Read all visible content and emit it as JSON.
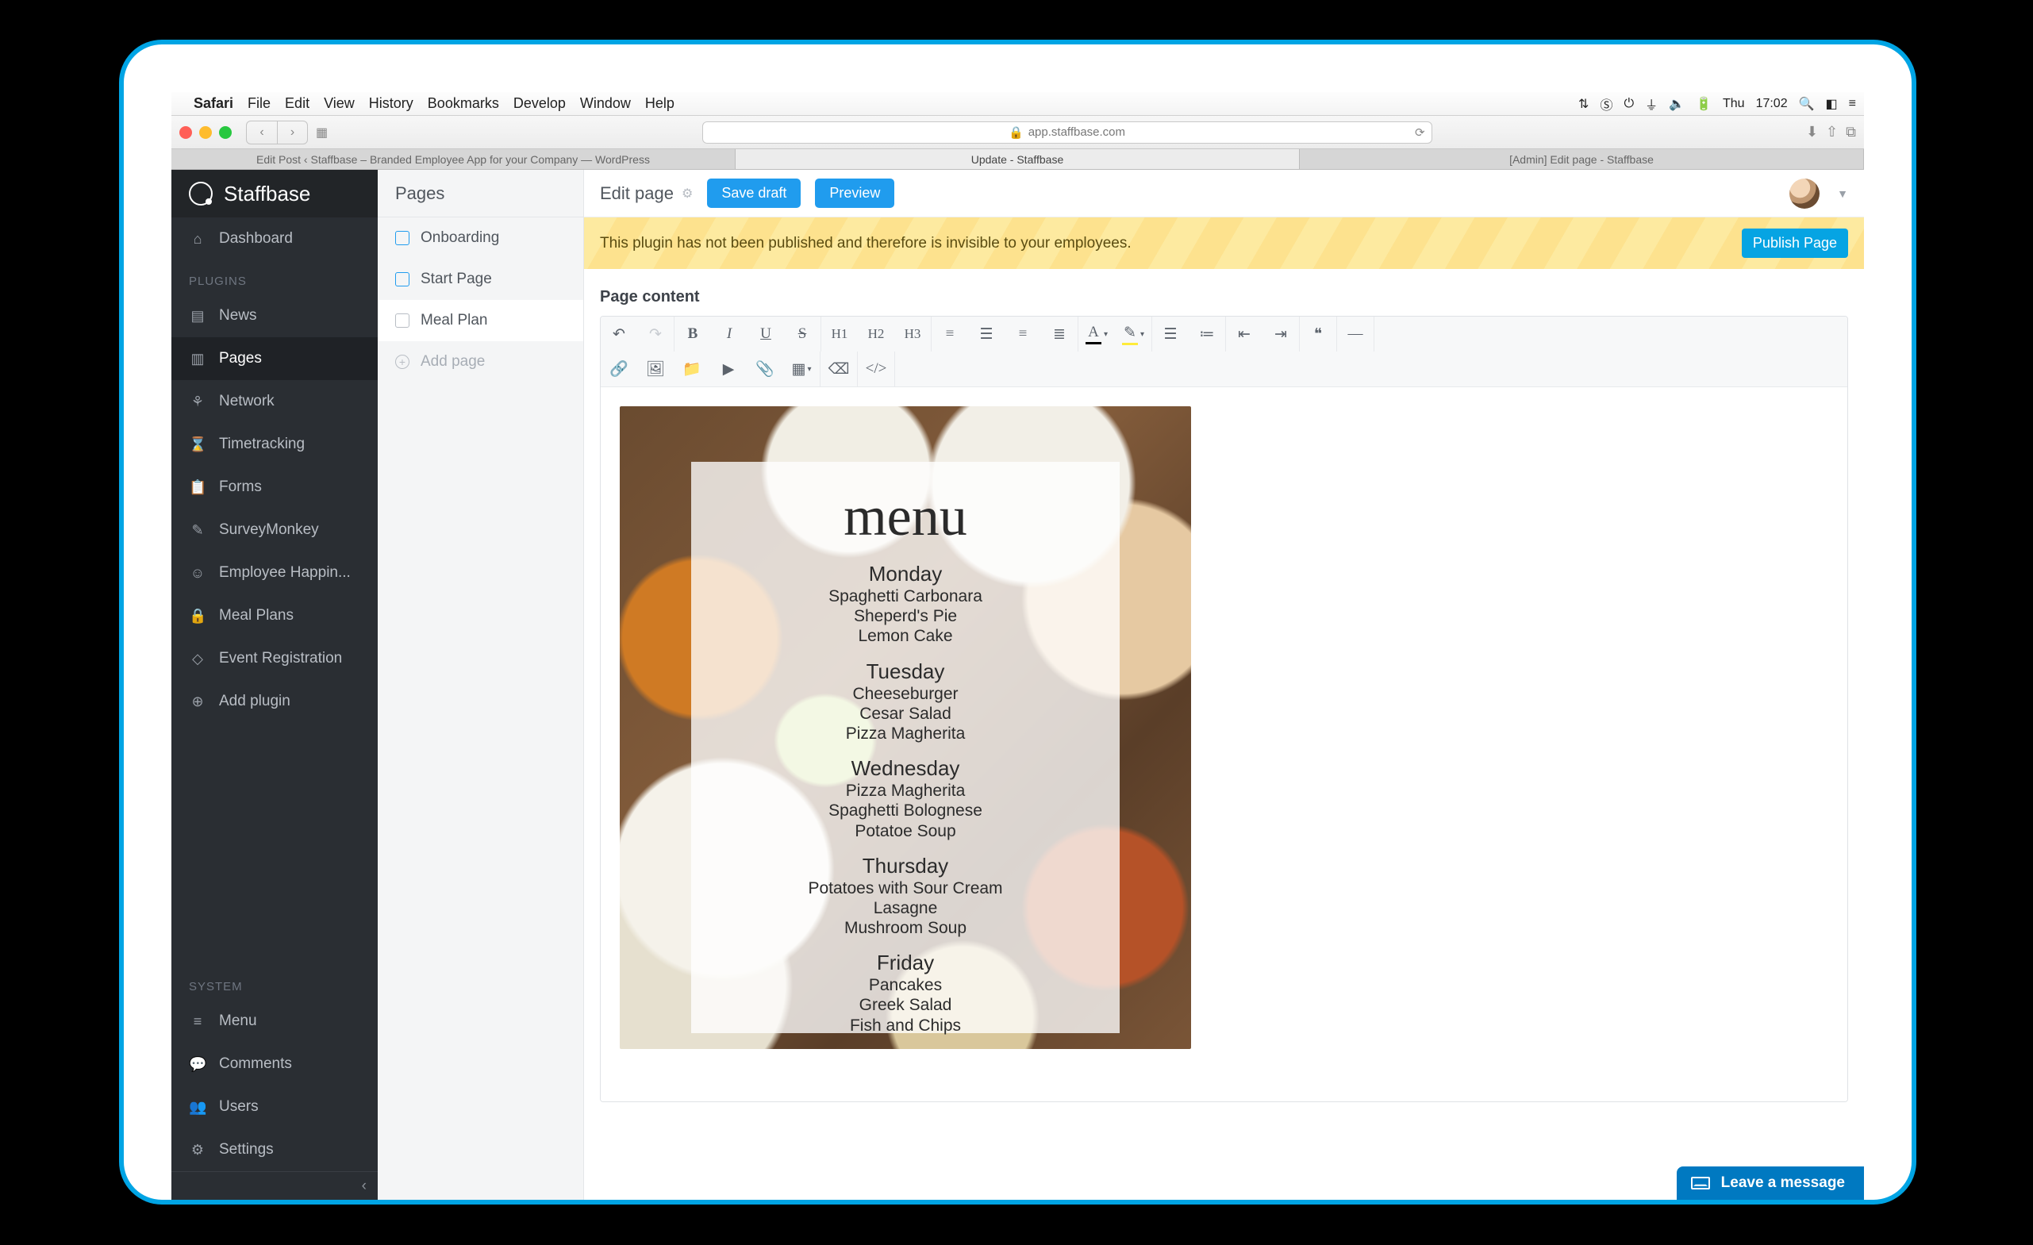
{
  "mac_menu": {
    "app": "Safari",
    "items": [
      "File",
      "Edit",
      "View",
      "History",
      "Bookmarks",
      "Develop",
      "Window",
      "Help"
    ],
    "right": {
      "day": "Thu",
      "time": "17:02"
    }
  },
  "safari": {
    "address": "app.staffbase.com",
    "tabs": [
      "Edit Post ‹ Staffbase – Branded Employee App for your Company — WordPress",
      "Update - Staffbase",
      "[Admin] Edit page - Staffbase"
    ],
    "active_tab_index": 1
  },
  "brand": "Staffbase",
  "sidebar": {
    "top": [
      {
        "icon": "⌂",
        "label": "Dashboard"
      }
    ],
    "plugins_header": "PLUGINS",
    "plugins": [
      {
        "icon": "▤",
        "label": "News"
      },
      {
        "icon": "▥",
        "label": "Pages",
        "active": true
      },
      {
        "icon": "⚘",
        "label": "Network"
      },
      {
        "icon": "⌛",
        "label": "Timetracking"
      },
      {
        "icon": "📋",
        "label": "Forms"
      },
      {
        "icon": "✎",
        "label": "SurveyMonkey"
      },
      {
        "icon": "☺",
        "label": "Employee Happin..."
      },
      {
        "icon": "🔒",
        "label": "Meal Plans"
      },
      {
        "icon": "◇",
        "label": "Event Registration"
      },
      {
        "icon": "⊕",
        "label": "Add plugin"
      }
    ],
    "system_header": "SYSTEM",
    "system": [
      {
        "icon": "≡",
        "label": "Menu"
      },
      {
        "icon": "💬",
        "label": "Comments"
      },
      {
        "icon": "👥",
        "label": "Users"
      },
      {
        "icon": "⚙",
        "label": "Settings"
      }
    ]
  },
  "pages_panel": {
    "title": "Pages",
    "items": [
      {
        "label": "Onboarding"
      },
      {
        "label": "Start Page"
      },
      {
        "label": "Meal Plan",
        "active": true,
        "grey": true
      }
    ],
    "add_label": "Add page"
  },
  "editor_header": {
    "title": "Edit page",
    "save": "Save draft",
    "preview": "Preview"
  },
  "banner": {
    "text": "This plugin has not been published and therefore is invisible to your employees.",
    "button": "Publish Page"
  },
  "content": {
    "section_title": "Page content",
    "menu_card": {
      "heading": "menu",
      "days": [
        {
          "name": "Monday",
          "dishes": [
            "Spaghetti Carbonara",
            "Sheperd's Pie",
            "Lemon Cake"
          ]
        },
        {
          "name": "Tuesday",
          "dishes": [
            "Cheeseburger",
            "Cesar Salad",
            "Pizza Magherita"
          ]
        },
        {
          "name": "Wednesday",
          "dishes": [
            "Pizza Magherita",
            "Spaghetti Bolognese",
            "Potatoe Soup"
          ]
        },
        {
          "name": "Thursday",
          "dishes": [
            "Potatoes with Sour Cream",
            "Lasagne",
            "Mushroom Soup"
          ]
        },
        {
          "name": "Friday",
          "dishes": [
            "Pancakes",
            "Greek Salad",
            "Fish and Chips"
          ]
        }
      ]
    }
  },
  "chat_widget": "Leave a message"
}
